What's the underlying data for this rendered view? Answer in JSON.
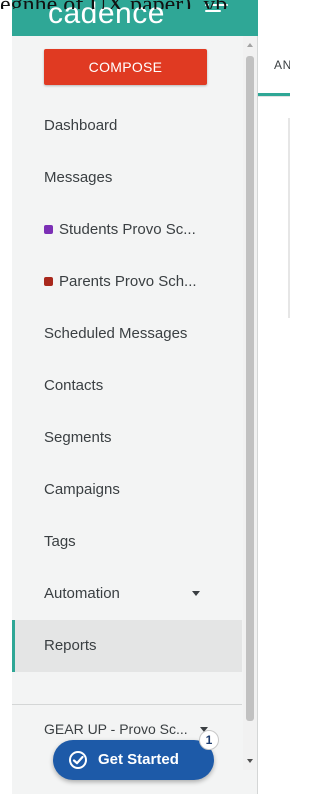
{
  "top_caption": "egnhe of UX paper), yb",
  "brand": {
    "logo_text": "cadence",
    "menu_icon": "hamburger-menu-icon"
  },
  "sidebar": {
    "compose_label": "COMPOSE",
    "items": [
      {
        "label": "Dashboard",
        "active": false
      },
      {
        "label": "Messages",
        "active": false
      },
      {
        "label": "Students Provo Sc...",
        "active": false,
        "swatch_color": "#7b2fb5"
      },
      {
        "label": "Parents Provo Sch...",
        "active": false,
        "swatch_color": "#a8281c"
      },
      {
        "label": "Scheduled Messages",
        "active": false
      },
      {
        "label": "Contacts",
        "active": false
      },
      {
        "label": "Segments",
        "active": false
      },
      {
        "label": "Campaigns",
        "active": false
      },
      {
        "label": "Tags",
        "active": false
      },
      {
        "label": "Automation",
        "active": false,
        "has_dropdown": true
      },
      {
        "label": "Reports",
        "active": true
      }
    ],
    "org_selector_label": "GEAR UP - Provo Sc..."
  },
  "main": {
    "tab_label": "AN"
  },
  "get_started": {
    "label": "Get Started",
    "badge_count": "1",
    "icon": "check-badge-icon"
  },
  "colors": {
    "brand_teal": "#2fa796",
    "compose_red": "#e03a22",
    "get_started_blue": "#1d5aa8",
    "sidebar_bg": "#f3f4f4",
    "active_item_bg": "#e4e5e5"
  }
}
